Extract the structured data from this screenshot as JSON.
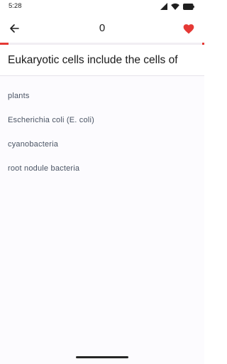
{
  "status_bar": {
    "time": "5:28"
  },
  "app_bar": {
    "score": "0",
    "back_icon": "arrow-left-icon",
    "favorite_icon": "heart-filled-icon"
  },
  "progress": {
    "fraction": 0.04
  },
  "question": {
    "text": "Eukaryotic cells include the cells of"
  },
  "options": [
    {
      "label": "plants"
    },
    {
      "label": "Escherichia coli (E. coli)"
    },
    {
      "label": "cyanobacteria"
    },
    {
      "label": "root nodule bacteria"
    }
  ],
  "colors": {
    "accent": "#e53935",
    "background": "#fcfbfe",
    "option_text": "#4a5464"
  }
}
